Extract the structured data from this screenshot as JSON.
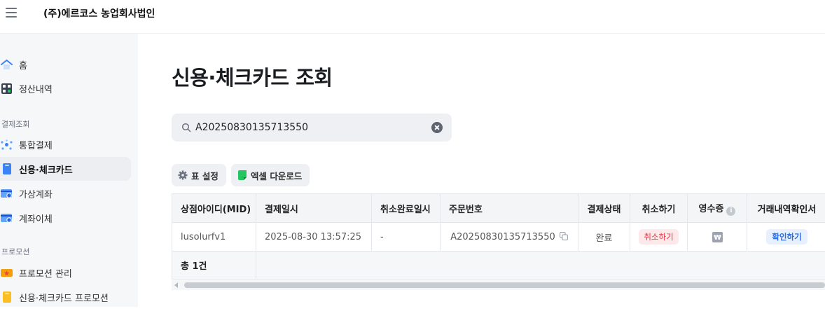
{
  "header": {
    "company": "(주)에르코스 농업회사법인"
  },
  "sidebar": {
    "items": [
      {
        "label": "홈",
        "icon": "home-icon"
      },
      {
        "label": "정산내역",
        "icon": "calculator-icon"
      },
      {
        "label": "통합결제",
        "icon": "network-icon"
      },
      {
        "label": "신용·체크카드",
        "icon": "card-icon",
        "active": true
      },
      {
        "label": "가상계좌",
        "icon": "virtual-account-icon"
      },
      {
        "label": "계좌이체",
        "icon": "transfer-icon"
      },
      {
        "label": "프로모션 관리",
        "icon": "ticket-icon"
      },
      {
        "label": "신용·체크카드 프로모션",
        "icon": "card-promo-icon"
      }
    ],
    "sections": [
      "결제조회",
      "프로모션"
    ]
  },
  "main": {
    "title": "신용·체크카드 조회",
    "search": {
      "value": "A20250830135713550"
    },
    "toolbar": {
      "table_settings": "표 설정",
      "excel_download": "엑셀 다운로드"
    },
    "table": {
      "headers": [
        "상점아이디(MID)",
        "결제일시",
        "취소완료일시",
        "주문번호",
        "결제상태",
        "취소하기",
        "영수증",
        "거래내역확인서"
      ],
      "row": {
        "mid": "lusolurfv1",
        "paid_at": "2025-08-30 13:57:25",
        "cancelled_at": "-",
        "order_no": "A20250830135713550",
        "status": "완료",
        "cancel_label": "취소하기",
        "confirm_label": "확인하기"
      },
      "total": "총 1건"
    }
  },
  "colors": {
    "accent_red": "#e53945",
    "accent_blue": "#2f6fe0",
    "sidebar_bg": "#f6f7f9"
  }
}
